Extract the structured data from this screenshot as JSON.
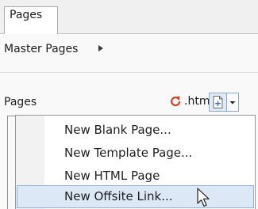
{
  "tab": {
    "label": "Pages"
  },
  "master_pages": {
    "label": "Master Pages",
    "arrow_icon": "play-right-icon"
  },
  "pages_section": {
    "label": "Pages",
    "html_link": {
      "icon": "refresh-icon",
      "label": ".html"
    },
    "add_button_icon": "add-page-icon",
    "dropdown_icon": "chevron-down-icon"
  },
  "menu": {
    "items": [
      {
        "label": "New Blank Page..."
      },
      {
        "label": "New Template Page..."
      },
      {
        "label": "New HTML Page"
      },
      {
        "label": "New Offsite Link...",
        "highlighted": true
      }
    ]
  },
  "colors": {
    "highlight": "#dce8f6",
    "highlight_border": "#8fb1dc",
    "refresh": "#e03a1e"
  }
}
